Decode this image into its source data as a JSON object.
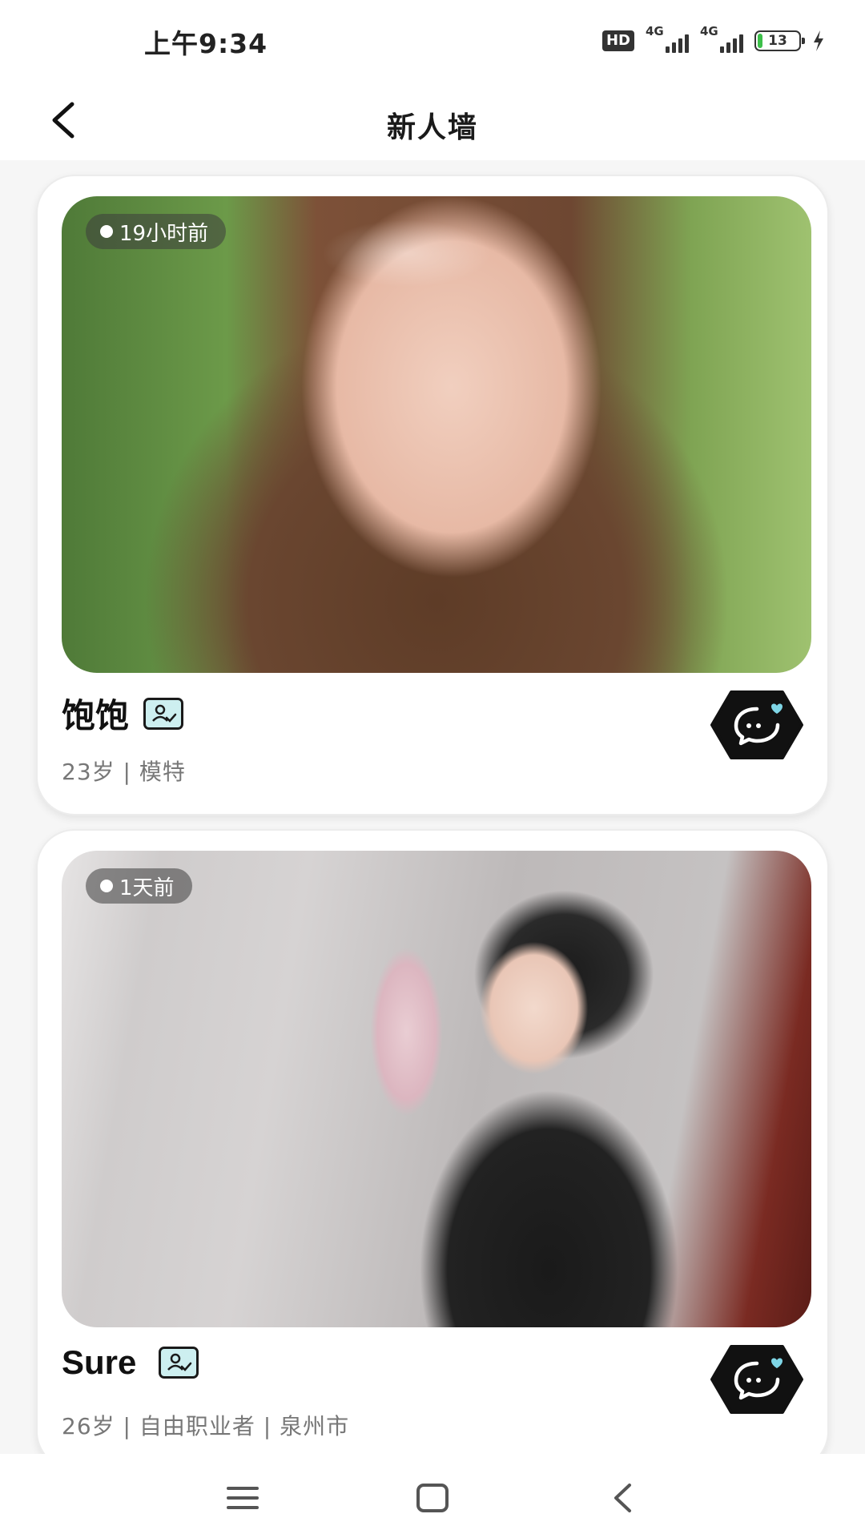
{
  "status_bar": {
    "time": "上午9:34",
    "hd_label": "HD",
    "network_1": "4G",
    "network_2": "4G",
    "battery": "13"
  },
  "header": {
    "title": "新人墙"
  },
  "cards": [
    {
      "time_ago": "19小时前",
      "name": "饱饱",
      "meta": "23岁 | 模特"
    },
    {
      "time_ago": "1天前",
      "name": "Sure",
      "meta": "26岁 | 自由职业者 | 泉州市"
    }
  ],
  "icons": {
    "back": "back-arrow-icon",
    "verified": "id-card-icon",
    "chat": "chat-heart-icon",
    "nav_menu": "menu-icon",
    "nav_home": "home-square-icon",
    "nav_back": "back-chevron-icon"
  },
  "colors": {
    "chat_button": "#111111",
    "chat_heart": "#7fd6e6",
    "id_icon_fill": "#cdeff0",
    "battery_level": "#3cbf4a"
  }
}
